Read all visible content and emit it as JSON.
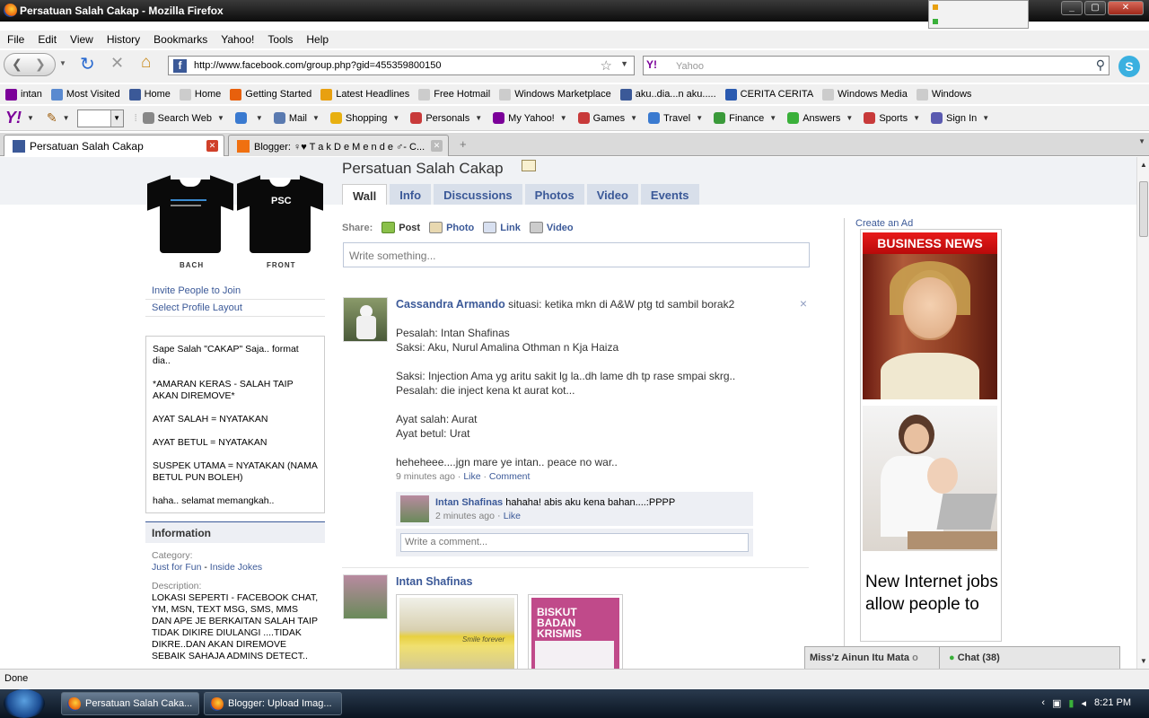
{
  "window": {
    "title": "Persatuan Salah Cakap - Mozilla Firefox"
  },
  "menubar": [
    "File",
    "Edit",
    "View",
    "History",
    "Bookmarks",
    "Yahoo!",
    "Tools",
    "Help"
  ],
  "navbar": {
    "url": "http://www.facebook.com/group.php?gid=455359800150",
    "search_placeholder": "Yahoo",
    "search_engine_logo": "Y!"
  },
  "bookmarks": [
    {
      "label": "intan",
      "icon": "yahoo-icon",
      "color": "#7b0099"
    },
    {
      "label": "Most Visited",
      "icon": "folder-icon",
      "color": "#5a8ad0"
    },
    {
      "label": "Home",
      "icon": "facebook-icon",
      "color": "#3b5998"
    },
    {
      "label": "Home",
      "icon": "page-icon",
      "color": "#cccccc"
    },
    {
      "label": "Getting Started",
      "icon": "firefox-icon",
      "color": "#e8600c"
    },
    {
      "label": "Latest Headlines",
      "icon": "rss-icon",
      "color": "#e8a010"
    },
    {
      "label": "Free Hotmail",
      "icon": "page-icon",
      "color": "#cccccc"
    },
    {
      "label": "Windows Marketplace",
      "icon": "page-icon",
      "color": "#cccccc"
    },
    {
      "label": "aku..dia...n aku.....",
      "icon": "facebook-icon",
      "color": "#3b5998"
    },
    {
      "label": "CERITA CERITA",
      "icon": "globe-icon",
      "color": "#2a5ab0"
    },
    {
      "label": "Windows Media",
      "icon": "page-icon",
      "color": "#cccccc"
    },
    {
      "label": "Windows",
      "icon": "page-icon",
      "color": "#cccccc"
    }
  ],
  "yahoo_toolbar": {
    "logo": "Y!",
    "items": [
      {
        "label": "Search Web",
        "icon": "search-web-icon",
        "color": "#888888"
      },
      {
        "label": "",
        "icon": "shield-icon",
        "color": "#3a7ad0"
      },
      {
        "label": "Mail",
        "icon": "mail-icon",
        "color": "#5a7ab0"
      },
      {
        "label": "Shopping",
        "icon": "shopping-icon",
        "color": "#e8b010"
      },
      {
        "label": "Personals",
        "icon": "personals-icon",
        "color": "#c83a3a"
      },
      {
        "label": "My Yahoo!",
        "icon": "my-yahoo-icon",
        "color": "#7b0099"
      },
      {
        "label": "Games",
        "icon": "games-icon",
        "color": "#c83a3a"
      },
      {
        "label": "Travel",
        "icon": "travel-icon",
        "color": "#3a7ad0"
      },
      {
        "label": "Finance",
        "icon": "finance-icon",
        "color": "#3a9a3a"
      },
      {
        "label": "Answers",
        "icon": "answers-icon",
        "color": "#3ab03a"
      },
      {
        "label": "Sports",
        "icon": "sports-icon",
        "color": "#c83a3a"
      },
      {
        "label": "Sign In",
        "icon": "sign-in-icon",
        "color": "#5a5ab0"
      }
    ]
  },
  "tabs": [
    {
      "label": "Persatuan Salah Cakap",
      "active": true
    },
    {
      "label": "Blogger: ♀♥ T a k D e M e n d e ♂- C...",
      "active": false
    }
  ],
  "page": {
    "left": {
      "shirt_labels": [
        "BACH",
        "FRONT"
      ],
      "shirt_logo": "PSC",
      "links": [
        "Invite People to Join",
        "Select Profile Layout"
      ],
      "description_lines": [
        "Sape Salah \"CAKAP\" Saja.. format dia..",
        "*AMARAN KERAS - SALAH TAIP AKAN DIREMOVE*",
        "AYAT SALAH = NYATAKAN",
        "AYAT BETUL = NYATAKAN",
        "SUSPEK UTAMA = NYATAKAN (NAMA BETUL PUN BOLEH)",
        "haha.. selamat memangkah.."
      ],
      "info_header": "Information",
      "category_label": "Category:",
      "category_link1": "Just for Fun",
      "category_sep": " - ",
      "category_link2": "Inside Jokes",
      "description_label": "Description:",
      "description_text": "LOKASI SEPERTI - FACEBOOK CHAT, YM, MSN, TEXT MSG, SMS, MMS DAN APE JE BERKAITAN SALAH TAIP TIDAK DIKIRE DIULANGI ....TIDAK DIKRE..DAN AKAN DIREMOVE SEBAIK SAHAJA ADMINS DETECT.."
    },
    "main": {
      "group_title": "Persatuan Salah Cakap",
      "tabs": [
        "Wall",
        "Info",
        "Discussions",
        "Photos",
        "Video",
        "Events"
      ],
      "share_label": "Share:",
      "share_options": [
        "Post",
        "Photo",
        "Link",
        "Video"
      ],
      "write_placeholder": "Write something...",
      "post1": {
        "author": "Cassandra Armando",
        "first_line": " situasi: ketika mkn di A&W ptg td sambil borak2",
        "lines": [
          "",
          "Pesalah: Intan Shafinas",
          "Saksi: Aku, Nurul Amalina Othman n Kja Haiza",
          "",
          "Saksi: Injection Ama yg aritu sakit lg la..dh lame dh tp rase smpai skrg..",
          "Pesalah: die inject kena kt aurat kot...",
          "",
          "Ayat salah: Aurat",
          "Ayat betul: Urat",
          "",
          "heheheee....jgn mare ye intan.. peace no war.."
        ],
        "time": "9 minutes ago",
        "sep": " · ",
        "like": "Like",
        "comment": "Comment",
        "close": "×"
      },
      "comment1": {
        "author": "Intan Shafinas",
        "text": " hahaha! abis aku kena bahan....:PPPP",
        "time": "2 minutes ago",
        "sep": " · ",
        "like": "Like"
      },
      "comment_placeholder": "Write a comment...",
      "post2": {
        "author": "Intan Shafinas",
        "photo1_caption": "Smile forever",
        "photo2_caption": "BISKUT BADAN KRISMIS"
      }
    },
    "right": {
      "create_ad": "Create an Ad",
      "ad_header": "BUSINESS NEWS",
      "ad_text": "New Internet jobs allow people to"
    }
  },
  "chatbar": {
    "contact": "Miss'z Ainun Itu Mata",
    "contact_status": "o",
    "chat_label": "Chat (38)"
  },
  "statusbar": {
    "text": "Done"
  },
  "taskbar": {
    "items": [
      "Persatuan Salah Caka...",
      "Blogger: Upload Imag..."
    ],
    "clock": "8:21 PM"
  }
}
